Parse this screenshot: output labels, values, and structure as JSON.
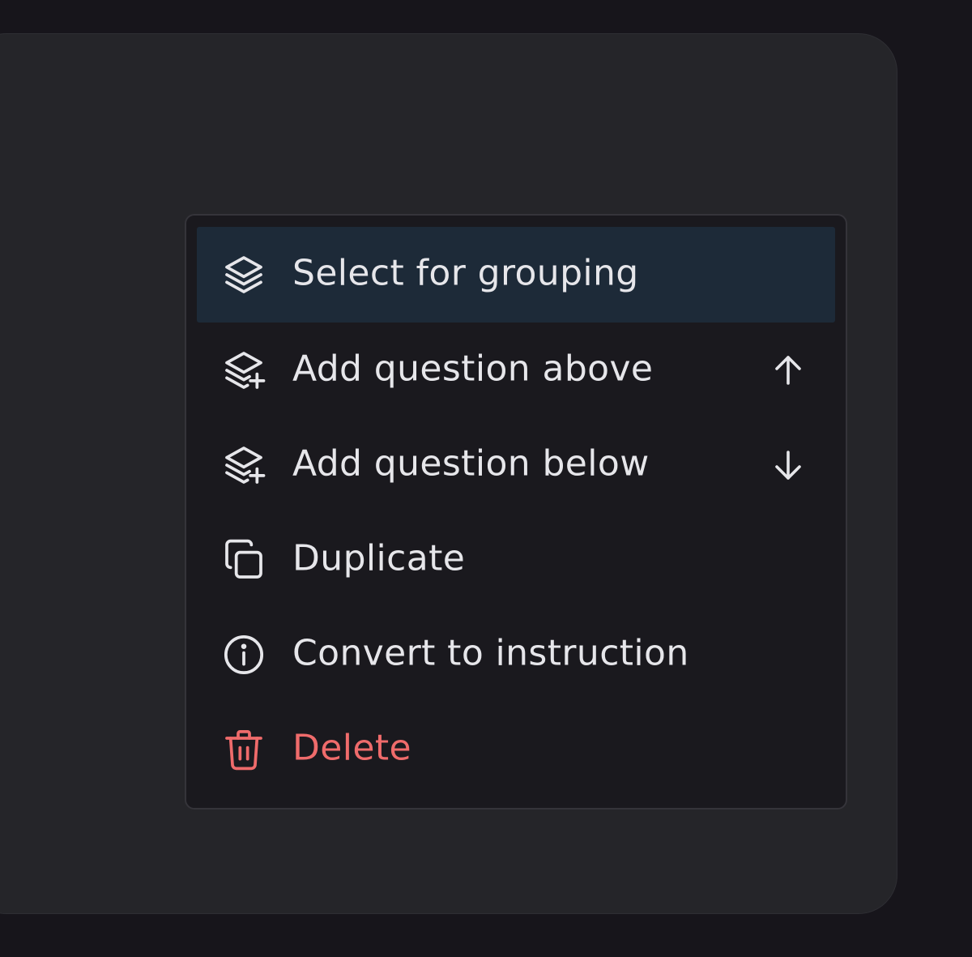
{
  "colors": {
    "background": "#17151b",
    "card": "#252529",
    "menu": "#1a191e",
    "highlight": "#1d2a38",
    "text": "#e6e6ea",
    "danger": "#ef6b6b"
  },
  "context_menu": {
    "items": [
      {
        "label": "Select for grouping",
        "icon": "layers-icon",
        "highlighted": true
      },
      {
        "label": "Add question above",
        "icon": "layers-plus-icon",
        "shortcut_icon": "arrow-up-icon"
      },
      {
        "label": "Add question below",
        "icon": "layers-plus-icon",
        "shortcut_icon": "arrow-down-icon"
      },
      {
        "label": "Duplicate",
        "icon": "copy-icon"
      },
      {
        "label": "Convert to instruction",
        "icon": "info-circle-icon"
      },
      {
        "label": "Delete",
        "icon": "trash-icon",
        "danger": true
      }
    ]
  }
}
